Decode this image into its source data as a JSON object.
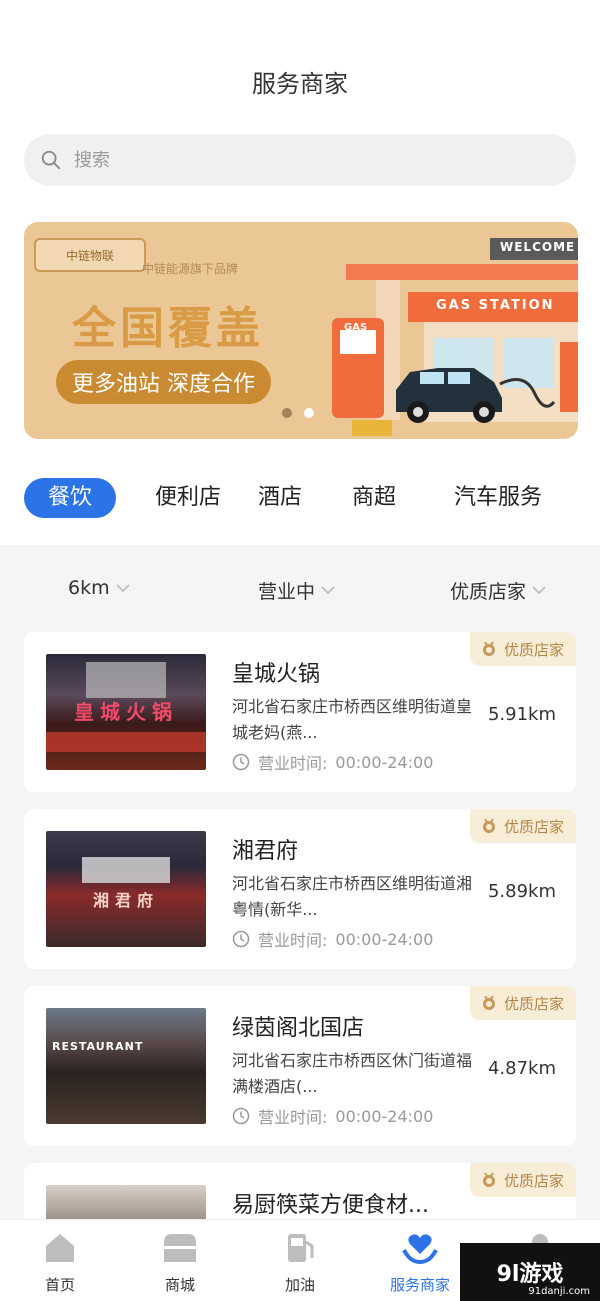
{
  "header": {
    "title": "服务商家"
  },
  "search": {
    "placeholder": "搜索"
  },
  "banner": {
    "logo_text": "中链物联",
    "subtitle": "中链能源旗下品牌",
    "welcome": "WELCOME",
    "station_sign": "GAS STATION",
    "pump_label": "GAS",
    "headline": "全国覆盖",
    "pill": "更多油站 深度合作",
    "pages": 2,
    "active_page": 2
  },
  "categories": [
    {
      "label": "餐饮",
      "active": true
    },
    {
      "label": "便利店",
      "active": false
    },
    {
      "label": "酒店",
      "active": false
    },
    {
      "label": "商超",
      "active": false
    },
    {
      "label": "汽车服务",
      "active": false
    }
  ],
  "filters": {
    "distance": "6km",
    "status": "营业中",
    "quality": "优质店家"
  },
  "merchants": [
    {
      "name": "皇城火锅",
      "address": "河北省石家庄市桥西区维明街道皇城老妈(燕...",
      "hours_label": "营业时间:",
      "hours": "00:00-24:00",
      "distance": "5.91km",
      "badge": "优质店家",
      "thumb_sign": "皇城火锅"
    },
    {
      "name": "湘君府",
      "address": "河北省石家庄市桥西区维明街道湘粤情(新华...",
      "hours_label": "营业时间:",
      "hours": "00:00-24:00",
      "distance": "5.89km",
      "badge": "优质店家",
      "thumb_sign": "湘君府"
    },
    {
      "name": "绿茵阁北国店",
      "address": "河北省石家庄市桥西区休门街道福满楼酒店(...",
      "hours_label": "营业时间:",
      "hours": "00:00-24:00",
      "distance": "4.87km",
      "badge": "优质店家",
      "thumb_sign": "RESTAURANT"
    },
    {
      "name": "易厨筷菜方便食材...",
      "badge": "优质店家"
    }
  ],
  "nav": [
    {
      "label": "首页",
      "icon": "home-icon",
      "active": false
    },
    {
      "label": "商城",
      "icon": "shop-icon",
      "active": false
    },
    {
      "label": "加油",
      "icon": "fuel-icon",
      "active": false
    },
    {
      "label": "服务商家",
      "icon": "heart-hands-icon",
      "active": true
    }
  ],
  "watermark": {
    "text": "9l游戏",
    "url_text": "91danji.com"
  },
  "colors": {
    "accent": "#2b73e6",
    "badge_bg": "#f8edd6",
    "badge_text": "#b3864a",
    "banner_bg": "#ebc796"
  }
}
